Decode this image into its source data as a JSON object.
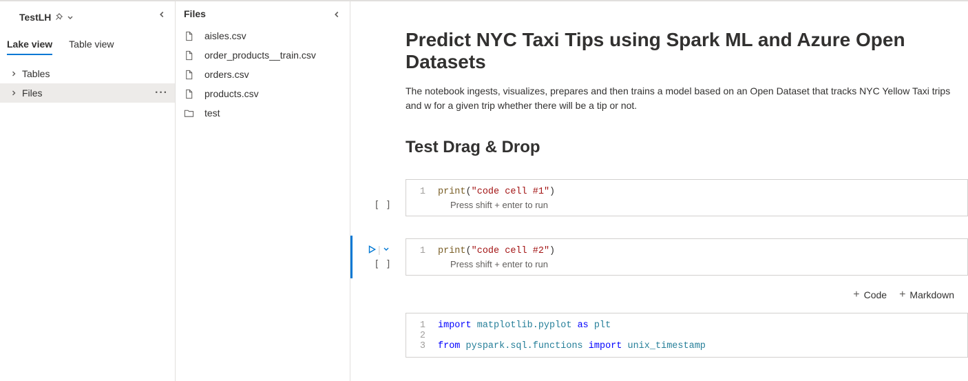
{
  "sidebar": {
    "name": "TestLH",
    "tabs": [
      {
        "label": "Lake view",
        "active": true
      },
      {
        "label": "Table view",
        "active": false
      }
    ],
    "tree": [
      {
        "label": "Tables",
        "selected": false
      },
      {
        "label": "Files",
        "selected": true
      }
    ]
  },
  "filesPanel": {
    "title": "Files",
    "items": [
      {
        "name": "aisles.csv",
        "type": "file"
      },
      {
        "name": "order_products__train.csv",
        "type": "file"
      },
      {
        "name": "orders.csv",
        "type": "file"
      },
      {
        "name": "products.csv",
        "type": "file"
      },
      {
        "name": "test",
        "type": "folder"
      }
    ]
  },
  "notebook": {
    "title": "Predict NYC Taxi Tips using Spark ML and Azure Open Datasets",
    "description": "The notebook ingests, visualizes, prepares and then trains a model based on an Open Dataset that tracks NYC Yellow Taxi trips and w for a given trip whether there will be a tip or not.",
    "subtitle": "Test Drag & Drop",
    "runHint": "Press shift + enter to run",
    "inserts": {
      "code": "Code",
      "markdown": "Markdown"
    },
    "cells": [
      {
        "prompt": "[ ]",
        "focused": false,
        "lines": [
          {
            "n": "1",
            "tokens": [
              {
                "t": "print",
                "cls": "fn"
              },
              {
                "t": "(",
                "cls": "plain"
              },
              {
                "t": "\"code cell #1\"",
                "cls": "str"
              },
              {
                "t": ")",
                "cls": "plain"
              }
            ]
          }
        ]
      },
      {
        "prompt": "[ ]",
        "focused": true,
        "lines": [
          {
            "n": "1",
            "tokens": [
              {
                "t": "print",
                "cls": "fn"
              },
              {
                "t": "(",
                "cls": "plain"
              },
              {
                "t": "\"code cell #2\"",
                "cls": "str"
              },
              {
                "t": ")",
                "cls": "plain"
              }
            ]
          }
        ]
      },
      {
        "prompt": "",
        "focused": false,
        "lines": [
          {
            "n": "1",
            "tokens": [
              {
                "t": "import",
                "cls": "kw"
              },
              {
                "t": " ",
                "cls": "plain"
              },
              {
                "t": "matplotlib.pyplot",
                "cls": "mod"
              },
              {
                "t": " ",
                "cls": "plain"
              },
              {
                "t": "as",
                "cls": "kw"
              },
              {
                "t": " ",
                "cls": "plain"
              },
              {
                "t": "plt",
                "cls": "mod"
              }
            ]
          },
          {
            "n": "2",
            "tokens": []
          },
          {
            "n": "3",
            "tokens": [
              {
                "t": "from",
                "cls": "kw"
              },
              {
                "t": " ",
                "cls": "plain"
              },
              {
                "t": "pyspark.sql.functions",
                "cls": "mod"
              },
              {
                "t": " ",
                "cls": "plain"
              },
              {
                "t": "import",
                "cls": "kw"
              },
              {
                "t": " ",
                "cls": "plain"
              },
              {
                "t": "unix_timestamp",
                "cls": "mod"
              }
            ]
          }
        ]
      }
    ]
  }
}
